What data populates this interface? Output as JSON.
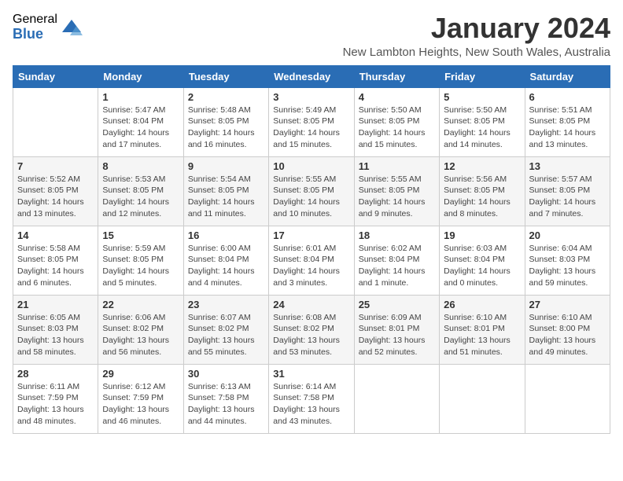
{
  "logo": {
    "general": "General",
    "blue": "Blue"
  },
  "title": "January 2024",
  "location": "New Lambton Heights, New South Wales, Australia",
  "weekdays": [
    "Sunday",
    "Monday",
    "Tuesday",
    "Wednesday",
    "Thursday",
    "Friday",
    "Saturday"
  ],
  "weeks": [
    [
      {
        "day": "",
        "info": ""
      },
      {
        "day": "1",
        "info": "Sunrise: 5:47 AM\nSunset: 8:04 PM\nDaylight: 14 hours\nand 17 minutes."
      },
      {
        "day": "2",
        "info": "Sunrise: 5:48 AM\nSunset: 8:05 PM\nDaylight: 14 hours\nand 16 minutes."
      },
      {
        "day": "3",
        "info": "Sunrise: 5:49 AM\nSunset: 8:05 PM\nDaylight: 14 hours\nand 15 minutes."
      },
      {
        "day": "4",
        "info": "Sunrise: 5:50 AM\nSunset: 8:05 PM\nDaylight: 14 hours\nand 15 minutes."
      },
      {
        "day": "5",
        "info": "Sunrise: 5:50 AM\nSunset: 8:05 PM\nDaylight: 14 hours\nand 14 minutes."
      },
      {
        "day": "6",
        "info": "Sunrise: 5:51 AM\nSunset: 8:05 PM\nDaylight: 14 hours\nand 13 minutes."
      }
    ],
    [
      {
        "day": "7",
        "info": "Sunrise: 5:52 AM\nSunset: 8:05 PM\nDaylight: 14 hours\nand 13 minutes."
      },
      {
        "day": "8",
        "info": "Sunrise: 5:53 AM\nSunset: 8:05 PM\nDaylight: 14 hours\nand 12 minutes."
      },
      {
        "day": "9",
        "info": "Sunrise: 5:54 AM\nSunset: 8:05 PM\nDaylight: 14 hours\nand 11 minutes."
      },
      {
        "day": "10",
        "info": "Sunrise: 5:55 AM\nSunset: 8:05 PM\nDaylight: 14 hours\nand 10 minutes."
      },
      {
        "day": "11",
        "info": "Sunrise: 5:55 AM\nSunset: 8:05 PM\nDaylight: 14 hours\nand 9 minutes."
      },
      {
        "day": "12",
        "info": "Sunrise: 5:56 AM\nSunset: 8:05 PM\nDaylight: 14 hours\nand 8 minutes."
      },
      {
        "day": "13",
        "info": "Sunrise: 5:57 AM\nSunset: 8:05 PM\nDaylight: 14 hours\nand 7 minutes."
      }
    ],
    [
      {
        "day": "14",
        "info": "Sunrise: 5:58 AM\nSunset: 8:05 PM\nDaylight: 14 hours\nand 6 minutes."
      },
      {
        "day": "15",
        "info": "Sunrise: 5:59 AM\nSunset: 8:05 PM\nDaylight: 14 hours\nand 5 minutes."
      },
      {
        "day": "16",
        "info": "Sunrise: 6:00 AM\nSunset: 8:04 PM\nDaylight: 14 hours\nand 4 minutes."
      },
      {
        "day": "17",
        "info": "Sunrise: 6:01 AM\nSunset: 8:04 PM\nDaylight: 14 hours\nand 3 minutes."
      },
      {
        "day": "18",
        "info": "Sunrise: 6:02 AM\nSunset: 8:04 PM\nDaylight: 14 hours\nand 1 minute."
      },
      {
        "day": "19",
        "info": "Sunrise: 6:03 AM\nSunset: 8:04 PM\nDaylight: 14 hours\nand 0 minutes."
      },
      {
        "day": "20",
        "info": "Sunrise: 6:04 AM\nSunset: 8:03 PM\nDaylight: 13 hours\nand 59 minutes."
      }
    ],
    [
      {
        "day": "21",
        "info": "Sunrise: 6:05 AM\nSunset: 8:03 PM\nDaylight: 13 hours\nand 58 minutes."
      },
      {
        "day": "22",
        "info": "Sunrise: 6:06 AM\nSunset: 8:02 PM\nDaylight: 13 hours\nand 56 minutes."
      },
      {
        "day": "23",
        "info": "Sunrise: 6:07 AM\nSunset: 8:02 PM\nDaylight: 13 hours\nand 55 minutes."
      },
      {
        "day": "24",
        "info": "Sunrise: 6:08 AM\nSunset: 8:02 PM\nDaylight: 13 hours\nand 53 minutes."
      },
      {
        "day": "25",
        "info": "Sunrise: 6:09 AM\nSunset: 8:01 PM\nDaylight: 13 hours\nand 52 minutes."
      },
      {
        "day": "26",
        "info": "Sunrise: 6:10 AM\nSunset: 8:01 PM\nDaylight: 13 hours\nand 51 minutes."
      },
      {
        "day": "27",
        "info": "Sunrise: 6:10 AM\nSunset: 8:00 PM\nDaylight: 13 hours\nand 49 minutes."
      }
    ],
    [
      {
        "day": "28",
        "info": "Sunrise: 6:11 AM\nSunset: 7:59 PM\nDaylight: 13 hours\nand 48 minutes."
      },
      {
        "day": "29",
        "info": "Sunrise: 6:12 AM\nSunset: 7:59 PM\nDaylight: 13 hours\nand 46 minutes."
      },
      {
        "day": "30",
        "info": "Sunrise: 6:13 AM\nSunset: 7:58 PM\nDaylight: 13 hours\nand 44 minutes."
      },
      {
        "day": "31",
        "info": "Sunrise: 6:14 AM\nSunset: 7:58 PM\nDaylight: 13 hours\nand 43 minutes."
      },
      {
        "day": "",
        "info": ""
      },
      {
        "day": "",
        "info": ""
      },
      {
        "day": "",
        "info": ""
      }
    ]
  ]
}
